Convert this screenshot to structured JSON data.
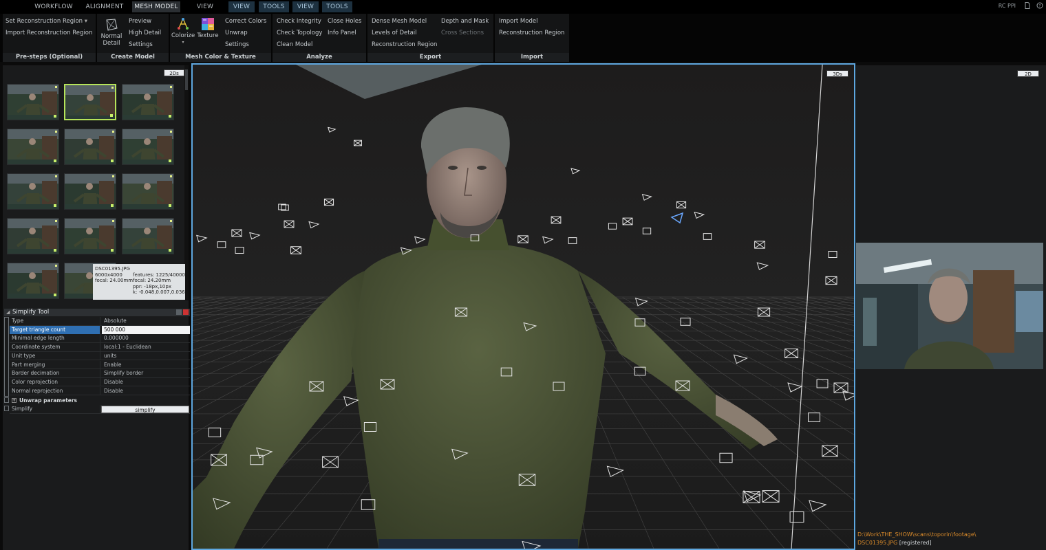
{
  "tabs": {
    "workflow": "WORKFLOW",
    "alignment": "ALIGNMENT",
    "mesh_model": "MESH MODEL",
    "view1": "VIEW",
    "view_ctx": "VIEW",
    "tools_ctx": "TOOLS",
    "view_ctx2": "VIEW",
    "tools_ctx2": "TOOLS"
  },
  "title_right": "RC PPI",
  "ribbon": {
    "presteps": {
      "title": "Pre-steps (Optional)",
      "set_region": "Set Reconstruction Region",
      "import_region": "Import Reconstruction Region"
    },
    "create_model": {
      "title": "Create Model",
      "normal_detail_line1": "Normal",
      "normal_detail_line2": "Detail",
      "preview": "Preview",
      "high_detail": "High Detail",
      "settings": "Settings"
    },
    "color_texture": {
      "title": "Mesh Color & Texture",
      "colorize": "Colorize",
      "texture": "Texture",
      "correct_colors": "Correct Colors",
      "unwrap": "Unwrap",
      "settings": "Settings"
    },
    "analyze": {
      "title": "Analyze",
      "check_integrity": "Check Integrity",
      "close_holes": "Close Holes",
      "check_topology": "Check Topology",
      "info_panel": "Info Panel",
      "clean_model": "Clean Model"
    },
    "export": {
      "title": "Export",
      "dense_mesh": "Dense Mesh Model",
      "depth_mask": "Depth and Mask",
      "lod": "Levels of Detail",
      "cross_sections": "Cross Sections",
      "recon_region": "Reconstruction Region"
    },
    "import": {
      "title": "Import",
      "import_model": "Import Model",
      "recon_region": "Reconstruction Region"
    }
  },
  "left_panel": {
    "mode_button": "2Ds",
    "tooltip": {
      "filename": "DSC01395.JPG",
      "resolution": "6000x4000",
      "focal": "focal: 24.00mm",
      "features": "features: 1225/40000",
      "focal2": "focal: 24.20mm",
      "ppr": "ppr: -18px,10px",
      "k": "k: -0.048,0.007,0.036"
    }
  },
  "simplify_tool": {
    "title": "Simplify Tool",
    "rows": [
      {
        "name": "Type",
        "value": "Absolute"
      },
      {
        "name": "Target triangle count",
        "value": "500 000"
      },
      {
        "name": "Minimal edge length",
        "value": "0.000000"
      },
      {
        "name": "Coordinate system",
        "value": "local:1 - Euclidean"
      },
      {
        "name": "Unit type",
        "value": "units"
      },
      {
        "name": "Part merging",
        "value": "Enable"
      },
      {
        "name": "Border decimation",
        "value": "Simplify border"
      },
      {
        "name": "Color reprojection",
        "value": "Disable"
      },
      {
        "name": "Normal reprojection",
        "value": "Disable"
      }
    ],
    "section": "Unwrap parameters",
    "action_label": "Simplify",
    "action_button": "simplify"
  },
  "viewport": {
    "mode_button": "3Ds"
  },
  "right_panel": {
    "mode_button": "2D",
    "path": "D:\\Work\\THE_SHOW\\scans\\toporin\\footage\\",
    "file": "DSC01395.JPG",
    "status": "[registered]"
  },
  "colors": {
    "accent_blue": "#5fa8e0",
    "selection_green": "#b6e45a",
    "highlight_row": "#2f6fb2",
    "path_orange": "#d98a2a",
    "sweater": "#4a5236"
  }
}
